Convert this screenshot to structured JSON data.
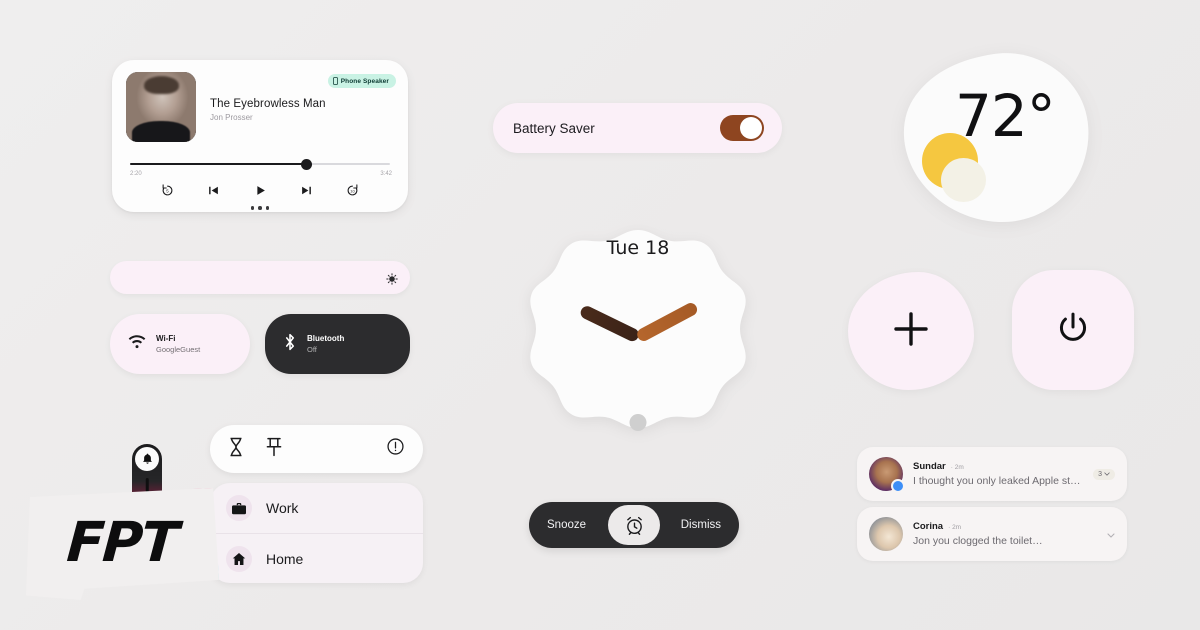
{
  "background_color": "#edecec",
  "media_player": {
    "track_title": "The Eyebrowless Man",
    "artist": "Jon Prosser",
    "output_chip": "Phone Speaker",
    "output_icon": "phone-icon",
    "elapsed_time": "2:20",
    "total_time": "3:42",
    "progress_percent": 66,
    "controls": {
      "rewind": "replay-5-icon",
      "previous": "skip-previous-icon",
      "play": "play-icon",
      "next": "skip-next-icon",
      "forward": "forward-10-icon"
    },
    "page_dots": 3
  },
  "brightness_slider": {
    "icon": "brightness-icon",
    "value_percent": 100
  },
  "quick_tiles": [
    {
      "title": "Wi-Fi",
      "subtitle": "GoogleGuest",
      "icon": "wifi-icon",
      "state": "on"
    },
    {
      "title": "Bluetooth",
      "subtitle": "Off",
      "icon": "bluetooth-icon",
      "state": "off"
    }
  ],
  "battery_saver": {
    "label": "Battery Saver",
    "toggle_state": "on",
    "toggle_color": "#8e4520"
  },
  "clock_widget": {
    "date_label": "Tue 18",
    "hour_hand_color": "#3a2218",
    "minute_hand_color": "#b5662c"
  },
  "weather_widget": {
    "temperature": "72°",
    "icon": "partly-cloudy-icon",
    "sun_color": "#f5c740",
    "cloud_color": "#f3f1e6"
  },
  "action_buttons": [
    {
      "name": "add-button",
      "icon": "plus-icon"
    },
    {
      "name": "power-button",
      "icon": "power-icon"
    }
  ],
  "shortcut_chips": [
    {
      "icon": "hourglass-icon",
      "name": "hourglass-chip"
    },
    {
      "icon": "pin-icon",
      "name": "pin-chip"
    },
    {
      "icon": "alert-circle-icon",
      "name": "alert-chip"
    }
  ],
  "shortcut_list": [
    {
      "label": "Work",
      "icon": "briefcase-icon"
    },
    {
      "label": "Home",
      "icon": "home-icon"
    }
  ],
  "alarm_bar": {
    "snooze_label": "Snooze",
    "dismiss_label": "Dismiss",
    "center_icon": "alarm-clock-icon"
  },
  "notifications": [
    {
      "name": "Sundar",
      "time": "· 2m",
      "message": "I thought you only leaked Apple stuff…",
      "count": "3",
      "has_badge": true
    },
    {
      "name": "Corina",
      "time": "· 2m",
      "message": "Jon you clogged the toilet…",
      "count": "",
      "has_badge": false
    }
  ],
  "watermark": {
    "text": "FPT",
    "bell_icon": "bell-icon"
  }
}
